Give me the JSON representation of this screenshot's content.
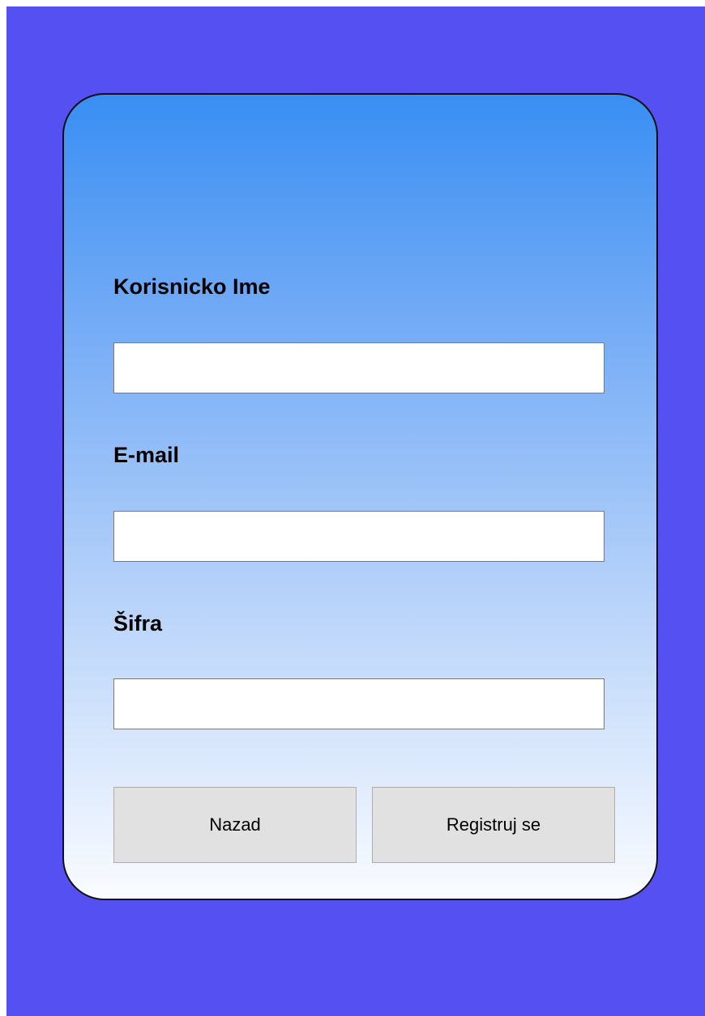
{
  "theme": {
    "window_background": "#5550f2",
    "card_gradient_top": "#398ef3",
    "card_gradient_bottom": "#fafcff",
    "button_background": "#e1e1e1"
  },
  "form": {
    "username": {
      "label": "Korisnicko Ime",
      "value": ""
    },
    "email": {
      "label": "E-mail",
      "value": ""
    },
    "password": {
      "label": "Šifra",
      "value": ""
    }
  },
  "actions": {
    "back_label": "Nazad",
    "register_label": "Registruj se"
  }
}
